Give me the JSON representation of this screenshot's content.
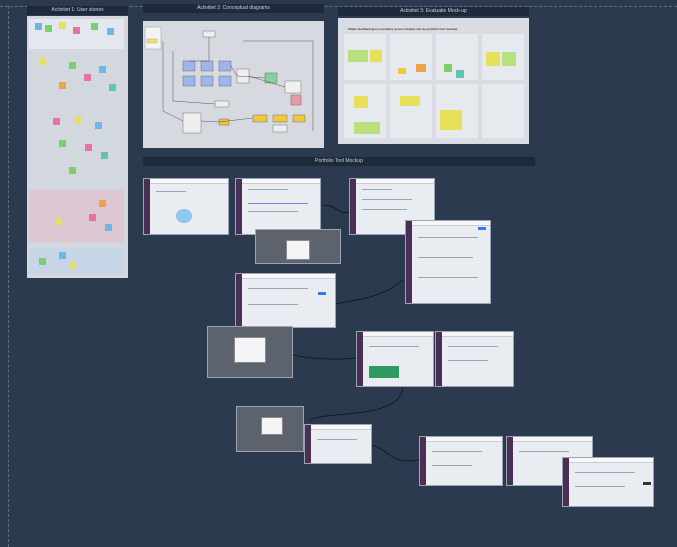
{
  "frames": {
    "activity1_title": "Activitiet 1: User stories",
    "activity2_title": "Activitiet 2: Conceptual diagrams",
    "activity3_title": "Activitiet 3: Evaluatie Mock-up",
    "activity3_heading": "Plaats feedback (post-comities) op het ontwerp van de portfolio tool mockup",
    "portfolio_title": "Portfolio Tool Mockup"
  },
  "colors": {
    "background": "#2b3a4f",
    "frame_header": "#1e2a3a",
    "frame_body": "#cdd2d9",
    "sidebar_purple": "#4a2f55"
  }
}
